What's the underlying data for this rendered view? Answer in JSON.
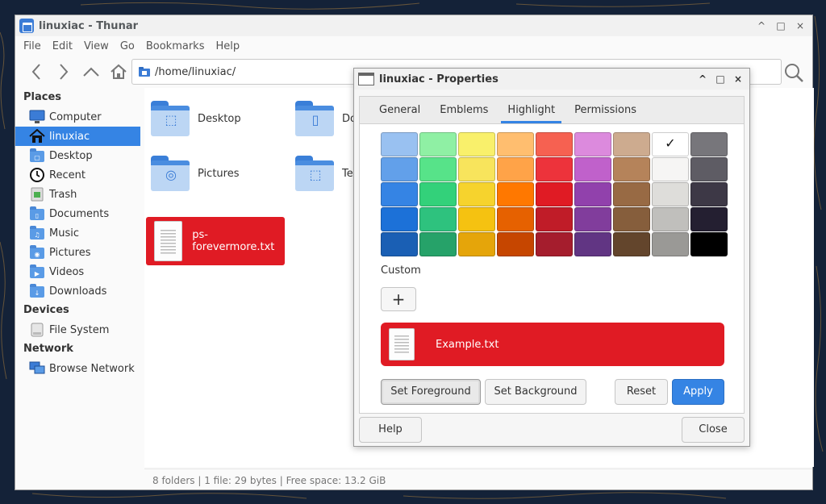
{
  "window": {
    "title": "linuxiac - Thunar",
    "controls": [
      "^",
      "□",
      "×"
    ]
  },
  "menu": [
    "File",
    "Edit",
    "View",
    "Go",
    "Bookmarks",
    "Help"
  ],
  "location": {
    "path": "/home/linuxiac/"
  },
  "sidebar": {
    "sections": [
      {
        "heading": "Places",
        "items": [
          {
            "label": "Computer",
            "icon": "computer-icon"
          },
          {
            "label": "linuxiac",
            "icon": "home-icon",
            "active": true
          },
          {
            "label": "Desktop",
            "icon": "desktop-folder-icon"
          },
          {
            "label": "Recent",
            "icon": "clock-icon"
          },
          {
            "label": "Trash",
            "icon": "trash-icon"
          },
          {
            "label": "Documents",
            "icon": "documents-folder-icon"
          },
          {
            "label": "Music",
            "icon": "music-folder-icon"
          },
          {
            "label": "Pictures",
            "icon": "pictures-folder-icon"
          },
          {
            "label": "Videos",
            "icon": "videos-folder-icon"
          },
          {
            "label": "Downloads",
            "icon": "downloads-folder-icon"
          }
        ]
      },
      {
        "heading": "Devices",
        "items": [
          {
            "label": "File System",
            "icon": "drive-icon"
          }
        ]
      },
      {
        "heading": "Network",
        "items": [
          {
            "label": "Browse Network",
            "icon": "network-icon"
          }
        ]
      }
    ]
  },
  "files": [
    {
      "label": "Desktop",
      "type": "folder"
    },
    {
      "label": "Do",
      "type": "folder"
    },
    {
      "label": "Pictures",
      "type": "folder"
    },
    {
      "label": "Te",
      "type": "folder"
    },
    {
      "label": "ps-forevermore.txt",
      "type": "text-file",
      "selected": true
    }
  ],
  "status": "8 folders  |  1 file: 29 bytes  |  Free space: 13.2 GiB",
  "dialog": {
    "title": "linuxiac - Properties",
    "controls": [
      "^",
      "□",
      "×"
    ],
    "tabs": [
      {
        "label": "General"
      },
      {
        "label": "Emblems"
      },
      {
        "label": "Highlight",
        "active": true
      },
      {
        "label": "Permissions"
      }
    ],
    "palette": [
      [
        "#99c1f1",
        "#8ff0a4",
        "#f9f06b",
        "#ffbe6f",
        "#f66151",
        "#dc8add",
        "#cdab8f",
        "#ffffff",
        "#77767b"
      ],
      [
        "#62a0ea",
        "#57e389",
        "#f8e45c",
        "#ffa348",
        "#ed333b",
        "#c061cb",
        "#b5835a",
        "#f6f5f4",
        "#5e5c64"
      ],
      [
        "#3584e4",
        "#33d17a",
        "#f6d32d",
        "#ff7800",
        "#e01b24",
        "#9141ac",
        "#986a44",
        "#deddda",
        "#3d3846"
      ],
      [
        "#1c71d8",
        "#2ec27e",
        "#f5c211",
        "#e66100",
        "#c01c28",
        "#813d9c",
        "#865e3c",
        "#c0bfbc",
        "#241f31"
      ],
      [
        "#1a5fb4",
        "#26a269",
        "#e5a50a",
        "#c64600",
        "#a51d2d",
        "#613583",
        "#63452c",
        "#9a9996",
        "#000000"
      ]
    ],
    "checked_swatch": [
      0,
      7
    ],
    "custom_label": "Custom",
    "add_label": "+",
    "preview": {
      "label": "Example.txt",
      "background": "#e01b24"
    },
    "buttons": {
      "set_foreground": "Set Foreground",
      "set_background": "Set Background",
      "reset": "Reset",
      "apply": "Apply",
      "help": "Help",
      "close": "Close"
    }
  }
}
